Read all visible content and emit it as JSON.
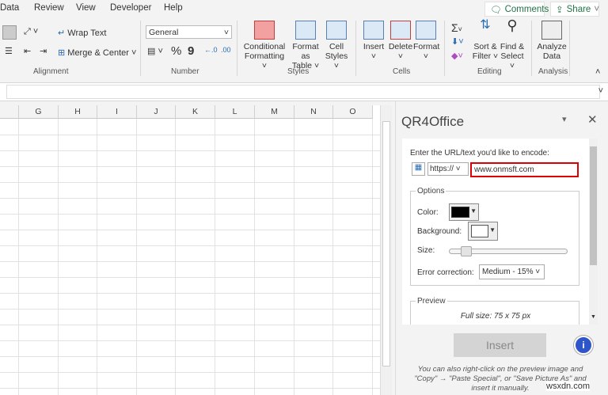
{
  "tabs": [
    "Data",
    "Review",
    "View",
    "Developer",
    "Help"
  ],
  "comments_label": "Comments",
  "share_label": "Share",
  "alignment": {
    "wrap_text": "Wrap Text",
    "merge_center": "Merge & Center",
    "label": "Alignment"
  },
  "number": {
    "format": "General",
    "label": "Number",
    "percent": "%",
    "comma": "9"
  },
  "styles": {
    "conditional": [
      "Conditional",
      "Formatting ˅"
    ],
    "format_table": [
      "Format as",
      "Table ˅"
    ],
    "cell_styles": [
      "Cell",
      "Styles ˅"
    ],
    "label": "Styles"
  },
  "cells": {
    "insert": "Insert",
    "delete": "Delete",
    "format": "Format",
    "label": "Cells"
  },
  "editing": {
    "sort": [
      "Sort &",
      "Filter ˅"
    ],
    "find": [
      "Find &",
      "Select ˅"
    ],
    "label": "Editing"
  },
  "analysis": {
    "analyze": [
      "Analyze",
      "Data"
    ],
    "label": "Analysis"
  },
  "columns": [
    "G",
    "H",
    "I",
    "J",
    "K",
    "L",
    "M",
    "N",
    "O"
  ],
  "pane": {
    "title": "QR4Office",
    "prompt": "Enter the URL/text you'd like to encode:",
    "protocol": "https://",
    "url": "www.onmsft.com",
    "options_label": "Options",
    "color_label": "Color:",
    "color": "#000000",
    "background_label": "Background:",
    "background": "#ffffff",
    "size_label": "Size:",
    "size_fraction": 0.1,
    "error_label": "Error correction:",
    "error_value": "Medium - 15%",
    "preview_label": "Preview",
    "full_size": "Full size: 75 x 75 px",
    "insert_label": "Insert",
    "hint": "You can also right-click on the preview image and \"Copy\" → \"Paste Special\", or \"Save Picture As\" and insert it manually."
  },
  "watermark": "wsxdn.com"
}
